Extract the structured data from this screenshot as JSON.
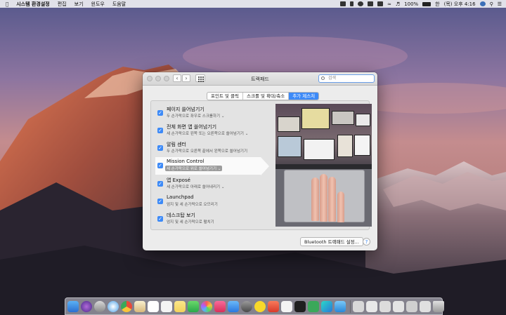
{
  "menubar": {
    "app_name": "시스템 환경설정",
    "menus": [
      "편집",
      "보기",
      "윈도우",
      "도움말"
    ],
    "battery": "100%",
    "clock": "(목) 오후 4:16"
  },
  "window": {
    "title": "트랙패드",
    "search_placeholder": "검색",
    "tabs": [
      {
        "label": "포인트 및 클릭"
      },
      {
        "label": "스크롤 및 확대/축소"
      },
      {
        "label": "추가 제스처"
      }
    ],
    "gestures": [
      {
        "title": "페이지 쓸어넘기기",
        "desc": "두 손가락으로 좌우로 스크롤하기 ⌄"
      },
      {
        "title": "전체 화면 앱 쓸어넘기기",
        "desc": "세 손가락으로 왼쪽 또는 오른쪽으로 쓸어넘기기 ⌄"
      },
      {
        "title": "알림 센터",
        "desc": "두 손가락으로 오른쪽 끝에서 왼쪽으로 쓸어넘기기"
      },
      {
        "title": "Mission Control",
        "desc": "세 손가락으로 위로 쓸어넘기기 ⌄"
      },
      {
        "title": "앱 Exposé",
        "desc": "세 손가락으로 아래로 쓸어내리기 ⌄"
      },
      {
        "title": "Launchpad",
        "desc": "엄지 및 세 손가락으로 오므리기"
      },
      {
        "title": "데스크탑 보기",
        "desc": "엄지 및 세 손가락으로 펼치기"
      }
    ],
    "selected_gesture": "Mission Control",
    "bluetooth_button": "Bluetooth 트랙패드 설정...",
    "help_button": "?"
  },
  "colors": {
    "accent": "#3d8af7",
    "selected_desc_bg": "#9c9c9c"
  }
}
